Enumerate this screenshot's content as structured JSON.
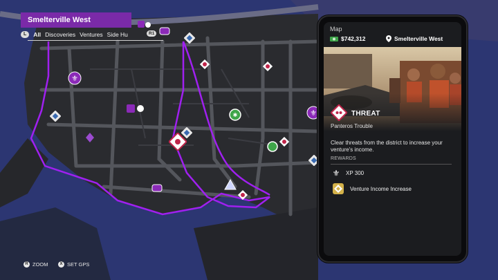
{
  "district": {
    "name": "Smelterville West"
  },
  "filters": {
    "left_key": "L",
    "tabs": [
      "All",
      "Discoveries",
      "Ventures",
      "Side Hu"
    ],
    "active": "All",
    "right_badge": "R1"
  },
  "hints": [
    {
      "key": "R",
      "label": "ZOOM"
    },
    {
      "key": "X",
      "label": "SET GPS"
    }
  ],
  "phone": {
    "title": "Map",
    "money": "$742,312",
    "location": "Smelterville West",
    "activity_type": "THREAT",
    "activity_name": "Panteros Trouble",
    "description": "Clear threats from the district to increase your venture's income.",
    "rewards_label": "REWARDS",
    "rewards": [
      {
        "icon": "xp-icon",
        "label": "XP 300"
      },
      {
        "icon": "venture-income-icon",
        "label": "Venture Income Increase"
      }
    ]
  },
  "colors": {
    "district_tag": "#7a2aa8",
    "boundary": "#a020f0",
    "water": "#2b3570",
    "land": "#2a2b2f",
    "road": "#4a4c52",
    "threat": "#c0254a",
    "venture_green": "#3fa54a"
  }
}
